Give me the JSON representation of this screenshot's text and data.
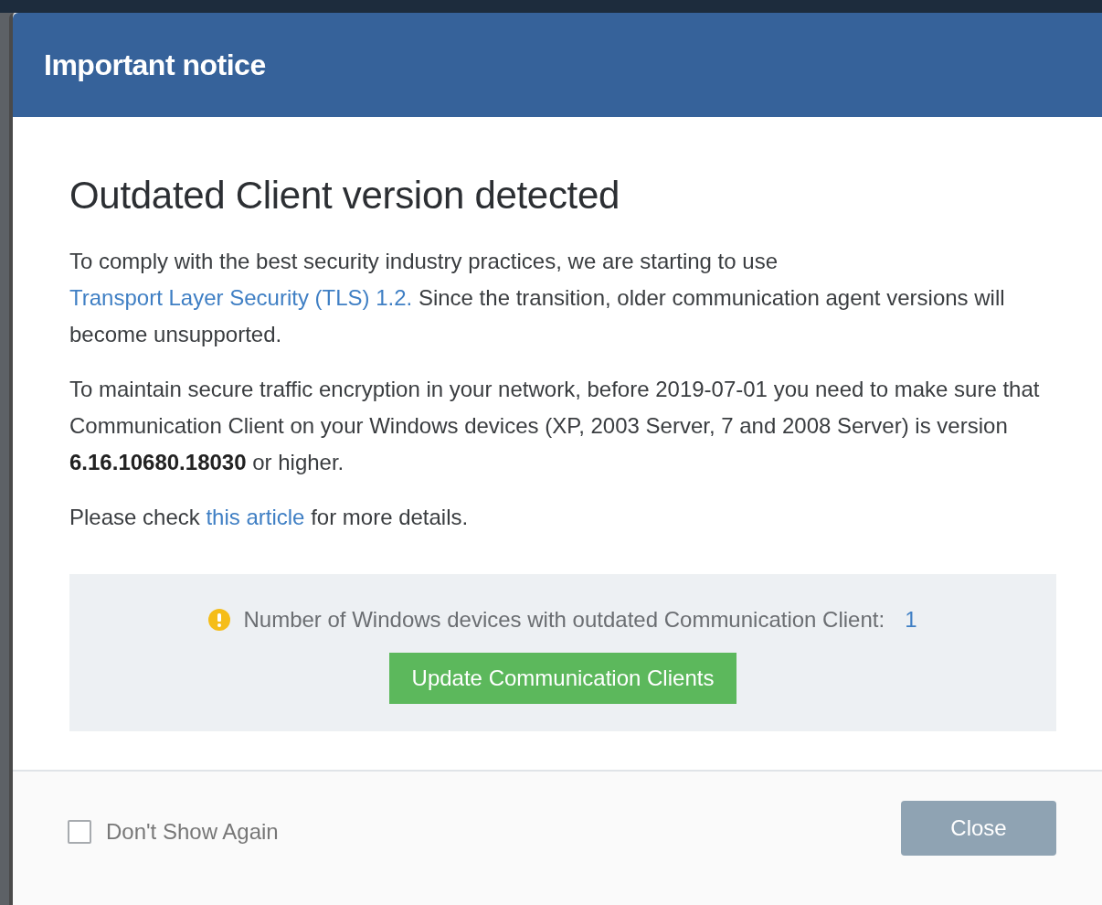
{
  "dialog": {
    "title": "Important notice"
  },
  "heading": "Outdated Client version detected",
  "paragraphs": [
    [
      {
        "kind": "text",
        "text": "To comply with the best security industry practices, we are starting to use "
      },
      {
        "kind": "link",
        "text": "Transport Layer Security (TLS) 1.2."
      },
      {
        "kind": "text",
        "text": " Since the transition, older communication agent versions will become unsupported."
      }
    ],
    [
      {
        "kind": "text",
        "text": "To maintain secure traffic encryption in your network, before 2019-07-01 you need to make sure that Communication Client on your Windows devices (XP, 2003 Server, 7 and 2008 Server) is version **6.16.10680.18030** or higher."
      }
    ],
    [
      {
        "kind": "text",
        "text": "Please check "
      },
      {
        "kind": "link",
        "text": "this article"
      },
      {
        "kind": "text",
        "text": " for more details."
      }
    ]
  ],
  "summary": {
    "label": "Number of Windows devices with outdated Communication Client:",
    "count": "1",
    "button": "Update Communication Clients"
  },
  "footer": {
    "checkbox": {
      "label": "Don't Show Again",
      "checked": false
    },
    "close_button": {
      "label": "Close",
      "disabled": true
    }
  }
}
